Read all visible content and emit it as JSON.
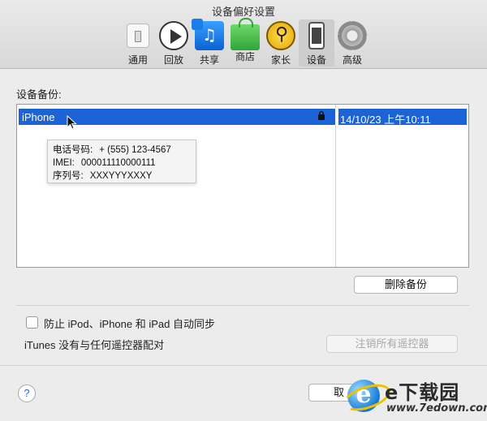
{
  "window": {
    "title": "设备偏好设置"
  },
  "toolbar": {
    "items": [
      {
        "label": "通用",
        "icon": "general-icon",
        "active": false
      },
      {
        "label": "回放",
        "icon": "playback-icon",
        "active": false
      },
      {
        "label": "共享",
        "icon": "sharing-icon",
        "active": false
      },
      {
        "label": "商店",
        "icon": "store-icon",
        "active": false
      },
      {
        "label": "家长",
        "icon": "parental-icon",
        "active": false
      },
      {
        "label": "设备",
        "icon": "devices-icon",
        "active": true
      },
      {
        "label": "高级",
        "icon": "advanced-icon",
        "active": false
      }
    ]
  },
  "backups": {
    "label": "设备备份:",
    "rows": [
      {
        "name": "iPhone",
        "locked": true,
        "lock_icon": "lock-icon",
        "date": "14/10/23 上午10:11",
        "selected": true
      }
    ],
    "selection_color": "#1c64d6"
  },
  "tooltip": {
    "lines": [
      {
        "key": "电话号码:",
        "value": "+ (555) 123-4567"
      },
      {
        "key": "IMEI:",
        "value": "000011110000111"
      },
      {
        "key": "序列号:",
        "value": "XXXYYYXXXY"
      }
    ]
  },
  "buttons": {
    "delete_backup": "删除备份",
    "unpair_remotes": "注销所有遥控器",
    "cancel_partial": "取"
  },
  "sync": {
    "prevent_label": "防止 iPod、iPhone 和 iPad 自动同步",
    "prevent_checked": false
  },
  "remotes": {
    "status": "iTunes 没有与任何遥控器配对"
  },
  "help": {
    "label": "?"
  },
  "watermark": {
    "title": "e下载园",
    "url": "www.7edown.com"
  }
}
